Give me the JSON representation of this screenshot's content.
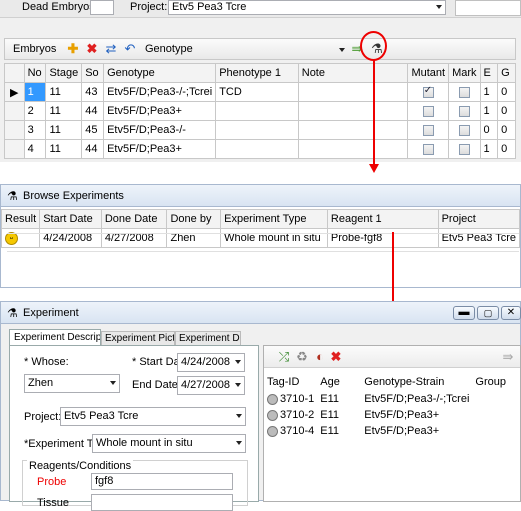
{
  "top": {
    "dead_label": "Dead Embryos:",
    "project_label": "Project:",
    "project_value": "Etv5 Pea3 Tcre"
  },
  "embryos": {
    "title": "Embryos",
    "genotype_label": "Genotype",
    "columns": [
      "No",
      "Stage",
      "So",
      "Genotype",
      "Phenotype 1",
      "Note",
      "Mutant",
      "Mark",
      "E",
      "G"
    ],
    "rows": [
      {
        "no": "1",
        "stage": "11",
        "so": "43",
        "genotype": "Etv5F/D;Pea3-/-;Tcrei",
        "phenotype": "TCD",
        "note": "",
        "mutant": true,
        "mark": false,
        "e": "1",
        "g": "0"
      },
      {
        "no": "2",
        "stage": "11",
        "so": "44",
        "genotype": "Etv5F/D;Pea3+",
        "phenotype": "",
        "note": "",
        "mutant": false,
        "mark": false,
        "e": "1",
        "g": "0"
      },
      {
        "no": "3",
        "stage": "11",
        "so": "45",
        "genotype": "Etv5F/D;Pea3-/-",
        "phenotype": "",
        "note": "",
        "mutant": false,
        "mark": false,
        "e": "0",
        "g": "0"
      },
      {
        "no": "4",
        "stage": "11",
        "so": "44",
        "genotype": "Etv5F/D;Pea3+",
        "phenotype": "",
        "note": "",
        "mutant": false,
        "mark": false,
        "e": "1",
        "g": "0"
      }
    ]
  },
  "browse": {
    "title": "Browse Experiments",
    "columns": [
      "Result",
      "Start Date",
      "Done Date",
      "Done by",
      "Experiment Type",
      "Reagent 1",
      "Project"
    ],
    "row": {
      "start": "4/24/2008",
      "done": "4/27/2008",
      "by": "Zhen",
      "type": "Whole mount in situ",
      "reagent": "Probe-fgf8",
      "project": "Etv5 Pea3 Tcre"
    }
  },
  "experiment": {
    "title": "Experiment",
    "tabs": [
      "Experiment Description",
      "Experiment Pictures",
      "Experiment Data"
    ],
    "whose_label": "* Whose:",
    "whose_value": "Zhen",
    "start_label": "* Start Date:",
    "start_value": "4/24/2008",
    "end_label": "End Date:",
    "end_value": "4/27/2008",
    "project_label": "Project:",
    "project_value": "Etv5 Pea3 Tcre",
    "type_label": "*Experiment Type:",
    "type_value": "Whole mount in situ",
    "reagents_label": "Reagents/Conditions",
    "probe_label": "Probe",
    "probe_value": "fgf8",
    "tissue_label": "Tissue",
    "tag_columns": [
      "Tag-ID",
      "Age",
      "Genotype-Strain",
      "Group"
    ],
    "tags": [
      {
        "id": "3710-1",
        "age": "E11",
        "strain": "Etv5F/D;Pea3-/-;Tcrei"
      },
      {
        "id": "3710-2",
        "age": "E11",
        "strain": "Etv5F/D;Pea3+"
      },
      {
        "id": "3710-4",
        "age": "E11",
        "strain": "Etv5F/D;Pea3+"
      }
    ]
  },
  "colors": {
    "accent": "#e00000",
    "selected": "#3399ff",
    "title_bg": "#d9e4f2"
  }
}
